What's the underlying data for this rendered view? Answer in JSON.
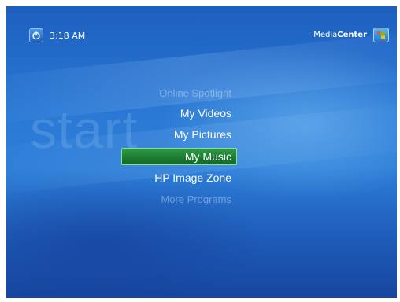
{
  "header": {
    "clock": "3:18 AM",
    "brand_light": "Media",
    "brand_bold": "Center"
  },
  "watermark": "start",
  "menu": {
    "items": [
      {
        "label": "Online Spotlight",
        "state": "faded"
      },
      {
        "label": "My Videos",
        "state": "normal"
      },
      {
        "label": "My Pictures",
        "state": "normal"
      },
      {
        "label": "My Music",
        "state": "selected"
      },
      {
        "label": "HP Image Zone",
        "state": "normal"
      },
      {
        "label": "More Programs",
        "state": "faded"
      }
    ]
  },
  "colors": {
    "background": "#2a78d4",
    "selection": "#1b7a31",
    "text": "#ffffff"
  },
  "icons": {
    "power": "power-icon",
    "logo": "windows-logo-icon"
  }
}
